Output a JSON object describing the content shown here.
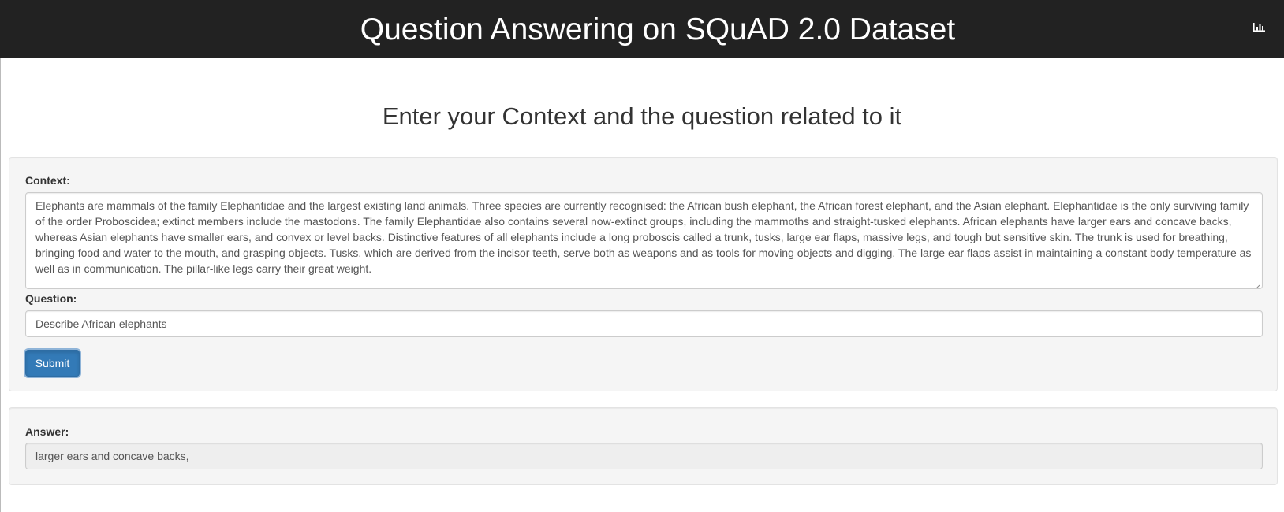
{
  "header": {
    "title": "Question Answering on SQuAD 2.0 Dataset",
    "icon": "bar-chart-icon"
  },
  "main": {
    "heading": "Enter your Context and the question related to it"
  },
  "form": {
    "context_label": "Context:",
    "context_value": "Elephants are mammals of the family Elephantidae and the largest existing land animals. Three species are currently recognised: the African bush elephant, the African forest elephant, and the Asian elephant. Elephantidae is the only surviving family of the order Proboscidea; extinct members include the mastodons. The family Elephantidae also contains several now-extinct groups, including the mammoths and straight-tusked elephants. African elephants have larger ears and concave backs, whereas Asian elephants have smaller ears, and convex or level backs. Distinctive features of all elephants include a long proboscis called a trunk, tusks, large ear flaps, massive legs, and tough but sensitive skin. The trunk is used for breathing, bringing food and water to the mouth, and grasping objects. Tusks, which are derived from the incisor teeth, serve both as weapons and as tools for moving objects and digging. The large ear flaps assist in maintaining a constant body temperature as well as in communication. The pillar-like legs carry their great weight.",
    "question_label": "Question:",
    "question_value": "Describe African elephants",
    "submit_label": "Submit"
  },
  "answer": {
    "label": "Answer:",
    "value": "larger ears and concave backs,"
  },
  "colors": {
    "navbar": "#222222",
    "primary_button": "#337ab7",
    "well": "#f5f5f5"
  }
}
